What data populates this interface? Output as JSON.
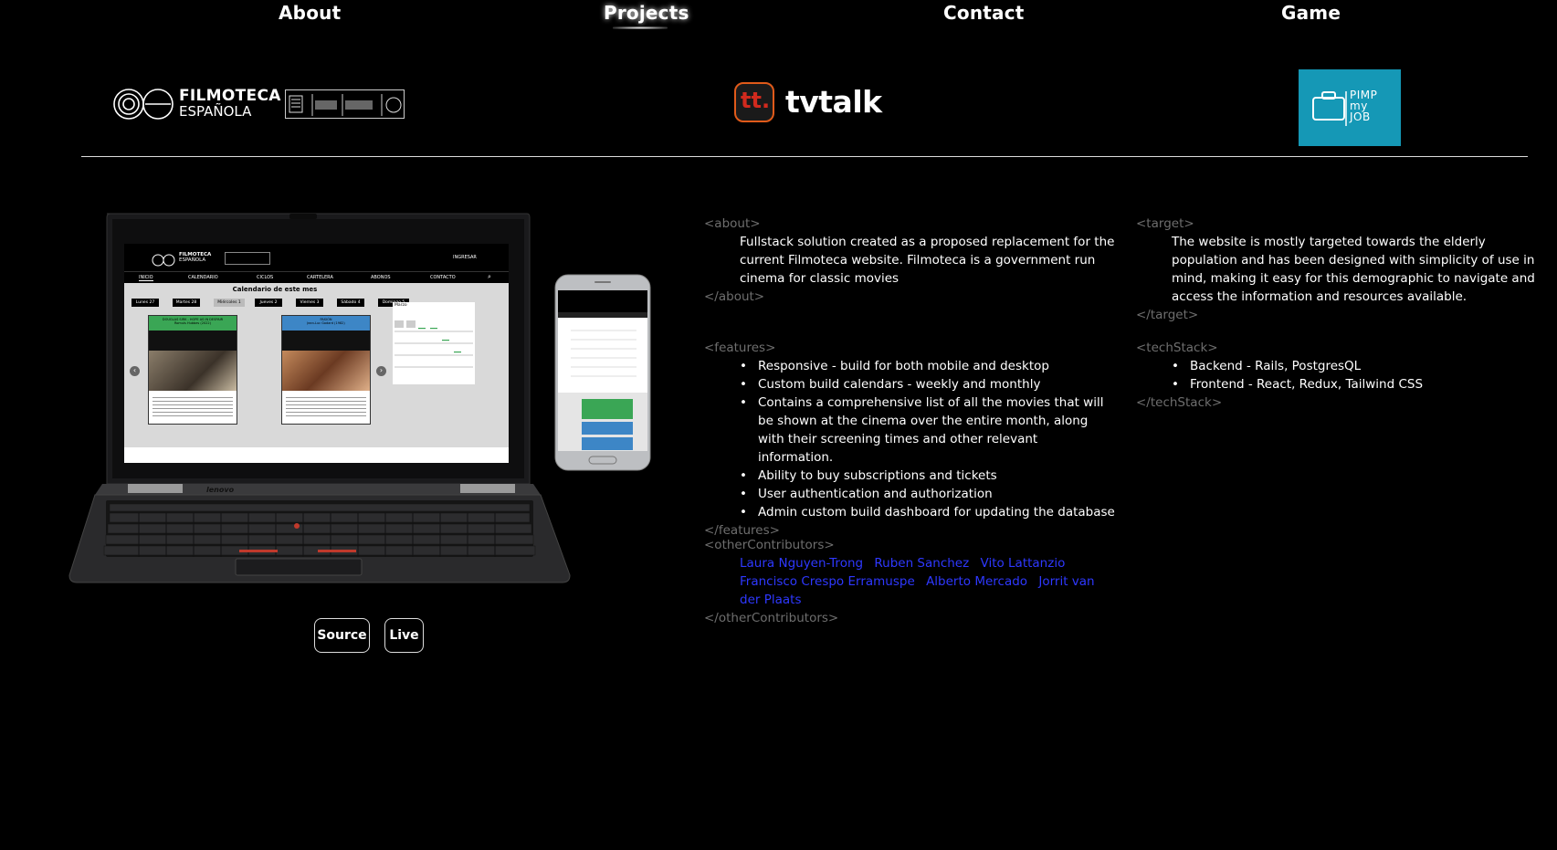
{
  "nav": {
    "items": [
      {
        "label": "About"
      },
      {
        "label": "Projects"
      },
      {
        "label": "Contact"
      },
      {
        "label": "Game"
      }
    ],
    "active": "Projects"
  },
  "projects": {
    "filmoteca": {
      "line1": "FILMOTECA",
      "line2": "ESPAÑOLA"
    },
    "tvtalk": {
      "badge": "tt.",
      "name": "tvtalk"
    },
    "pimpmyjob": {
      "lines": [
        "PIMP",
        "my",
        "JOB"
      ]
    }
  },
  "showcase": {
    "laptop_brand": "lenovo",
    "screen": {
      "logo1": "FILMOTECA",
      "logo2": "ESPAÑOLA",
      "login": "INGRESAR",
      "menu": [
        "INICIO",
        "CALENDARIO",
        "CICLOS",
        "CARTELERA",
        "ABONOS",
        "CONTACTO"
      ],
      "heading": "Calendario de este mes",
      "days": [
        "Lunes 27",
        "Martes 28",
        "Miércoles 1",
        "Jueves 2",
        "Viernes 3",
        "Sábado 4",
        "Domingo 5"
      ],
      "card1_title": "DOUGLAS SIRK - HOPE AS IN DESPAIR",
      "card1_sub": "Romuls Hubbes (2022)",
      "card2_title": "PASIÓN",
      "card2_sub": "Jean-Luc Godard (1982)",
      "month": "Marzo"
    }
  },
  "buttons": {
    "source": "Source",
    "live": "Live"
  },
  "about": {
    "open": "<about>",
    "text": "Fullstack solution created as a proposed replacement for the current Filmoteca website. Filmoteca is a government run cinema for classic movies",
    "close": "</about>"
  },
  "target": {
    "open": "<target>",
    "text": "The website is mostly targeted towards the elderly population and has been designed with simplicity of use in mind, making it easy for this demographic to navigate and access the information and resources available.",
    "close": "</target>"
  },
  "features": {
    "open": "<features>",
    "items": [
      "Responsive - build for both mobile and desktop",
      "Custom build calendars - weekly and monthly",
      "Contains a comprehensive list of all the movies that will be shown at the cinema over the entire month, along with their screening times and other relevant information.",
      "Ability to buy subscriptions and tickets",
      "User authentication and authorization",
      "Admin custom build dashboard for updating the database"
    ],
    "close": "</features>"
  },
  "techStack": {
    "open": "<techStack>",
    "items": [
      "Backend - Rails, PostgresQL",
      "Frontend - React, Redux, Tailwind CSS"
    ],
    "close": "</techStack>"
  },
  "otherContributors": {
    "open": "<otherContributors>",
    "names": [
      "Laura Nguyen-Trong",
      "Ruben Sanchez",
      "Vito Lattanzio",
      "Francisco Crespo Erramuspe",
      "Alberto Mercado",
      "Jorrit van der Plaats"
    ],
    "close": "</otherContributors>"
  },
  "colors": {
    "background": "#000000",
    "tag": "#6e6e6e",
    "link": "#2e38ff",
    "pimpmyjob": "#1598b6",
    "tvtalk_accent": "#d12a1e"
  }
}
